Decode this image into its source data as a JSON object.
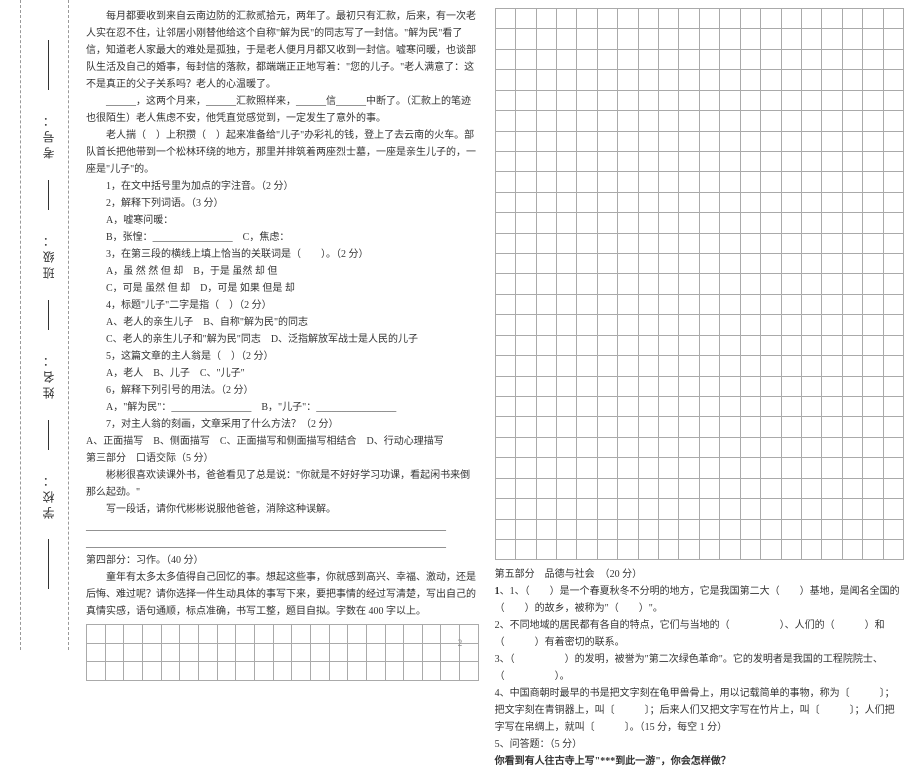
{
  "binding": {
    "school": "学校：",
    "name": "姓名：",
    "class": "班级：",
    "examno": "考号："
  },
  "left": {
    "para1": "每月都要收到来自云南边防的汇款贰拾元，两年了。最初只有汇款，后来，有一次老人实在忍不住，让邻居小刚替他给这个自称\"解为民\"的同志写了一封信。\"解为民\"看了信，知道老人家最大的难处是孤独，于是老人便月月都又收到一封信。嘘寒问暖，也谈部队生活及自己的婚事，每封信的落款，都端端正正地写着：\"您的儿子。\"老人满意了：这不是真正的父子关系吗？老人的心温暖了。",
    "para2": "______，这两个月来，______汇款照样来，______信______中断了。（汇款上的笔迹也很陌生）老人焦虑不安，他凭直觉感觉到，一定发生了意外的事。",
    "para3": "老人揣（　）上积攒（　）起来准备给\"儿子\"办彩礼的钱，登上了去云南的火车。部队首长把他带到一个松林环绕的地方，那里并排筑着两座烈士墓，一座是亲生儿子的，一座是\"儿子\"的。",
    "q1": "1，在文中括号里为加点的字注音。（2 分）",
    "q2": "2，解释下列词语。（3 分）",
    "q2a": "A，嘘寒问暖：",
    "q2b": "B，张惶：________________　C，焦虑：",
    "q3": "3，在第三段的横线上填上恰当的关联词是（　　）。（2 分）",
    "q3a": "A，虽  然  然  但  却　B，于是  虽然  却  但",
    "q3b": "C，可是  虽然  但  却　D，可是  如果  但是  却",
    "q4": "4，标题\"儿子\"二字是指（　）（2 分）",
    "q4a": "A、老人的亲生儿子　B、自称\"解为民\"的同志",
    "q4b": "C、老人的亲生儿子和\"解为民\"同志　D、泛指解放军战士是人民的儿子",
    "q5": "5，这篇文章的主人翁是（　）（2 分）",
    "q5a": "A，老人　B、儿子　C、\"儿子\"",
    "q6": "6，解释下列引号的用法。（2 分）",
    "q6a": "A，\"解为民\"：________________　B，\"儿子\"：________________",
    "q7": "7，对主人翁的刻画，文章采用了什么方法？（2 分）",
    "q7opts": "A、正面描写　B、侧面描写　C、正面描写和侧面描写相结合　D、行动心理描写",
    "sec3title": "第三部分　口语交际（5 分）",
    "sec3_p1": "彬彬很喜欢读课外书，爸爸看见了总是说：\"你就是不好好学习功课，看起闲书来倒那么起劲。\"",
    "sec3_p2": "写一段话，请你代彬彬说服他爸爸，消除这种误解。",
    "sec4title": "第四部分：习作。（40 分）",
    "sec4_p1": "童年有太多太多值得自己回忆的事。想起这些事，你就感到高兴、幸福、激动，还是后悔、难过呢？请你选择一件生动具体的事写下来，要把事情的经过写清楚，写出自己的真情实感，语句通顺，标点准确，书写工整，题目自拟。字数在 400 字以上。"
  },
  "right": {
    "grid_top_rows": 27,
    "grid_top_cols": 20,
    "sec5title": "第五部分　品德与社会　（20 分）",
    "r1": "1、（　　）是一个春夏秋冬不分明的地方，它是我国第二大（　　）基地，是闻名全国的（　　）的故乡，被称为\"（　　）\"。",
    "r2": "2、不同地域的居民都有各自的特点，它们与当地的（　　　　　）、人们的（　　　）和（　　　）有着密切的联系。",
    "r3": "3、（　　　　　）的发明，被誉为\"第二次绿色革命\"。它的发明者是我国的工程院院士、（　　　　　）。",
    "r4": "4、中国商朝时最早的书是把文字刻在龟甲兽骨上，用以记载简单的事物，称为〔　　　〕；把文字刻在青铜器上，叫〔　　　〕；后来人们又把文字写在竹片上，叫〔　　　〕；人们把字写在帛绸上，就叫〔　　　〕。（15 分，每空 1 分）",
    "r5": "5、问答题：（5 分）",
    "r5q": "你看到有人往古寺上写\"***到此一游\"，你会怎样做？",
    "grid_bot_rows": 3,
    "grid_bot_cols": 21
  },
  "page_number": "2"
}
